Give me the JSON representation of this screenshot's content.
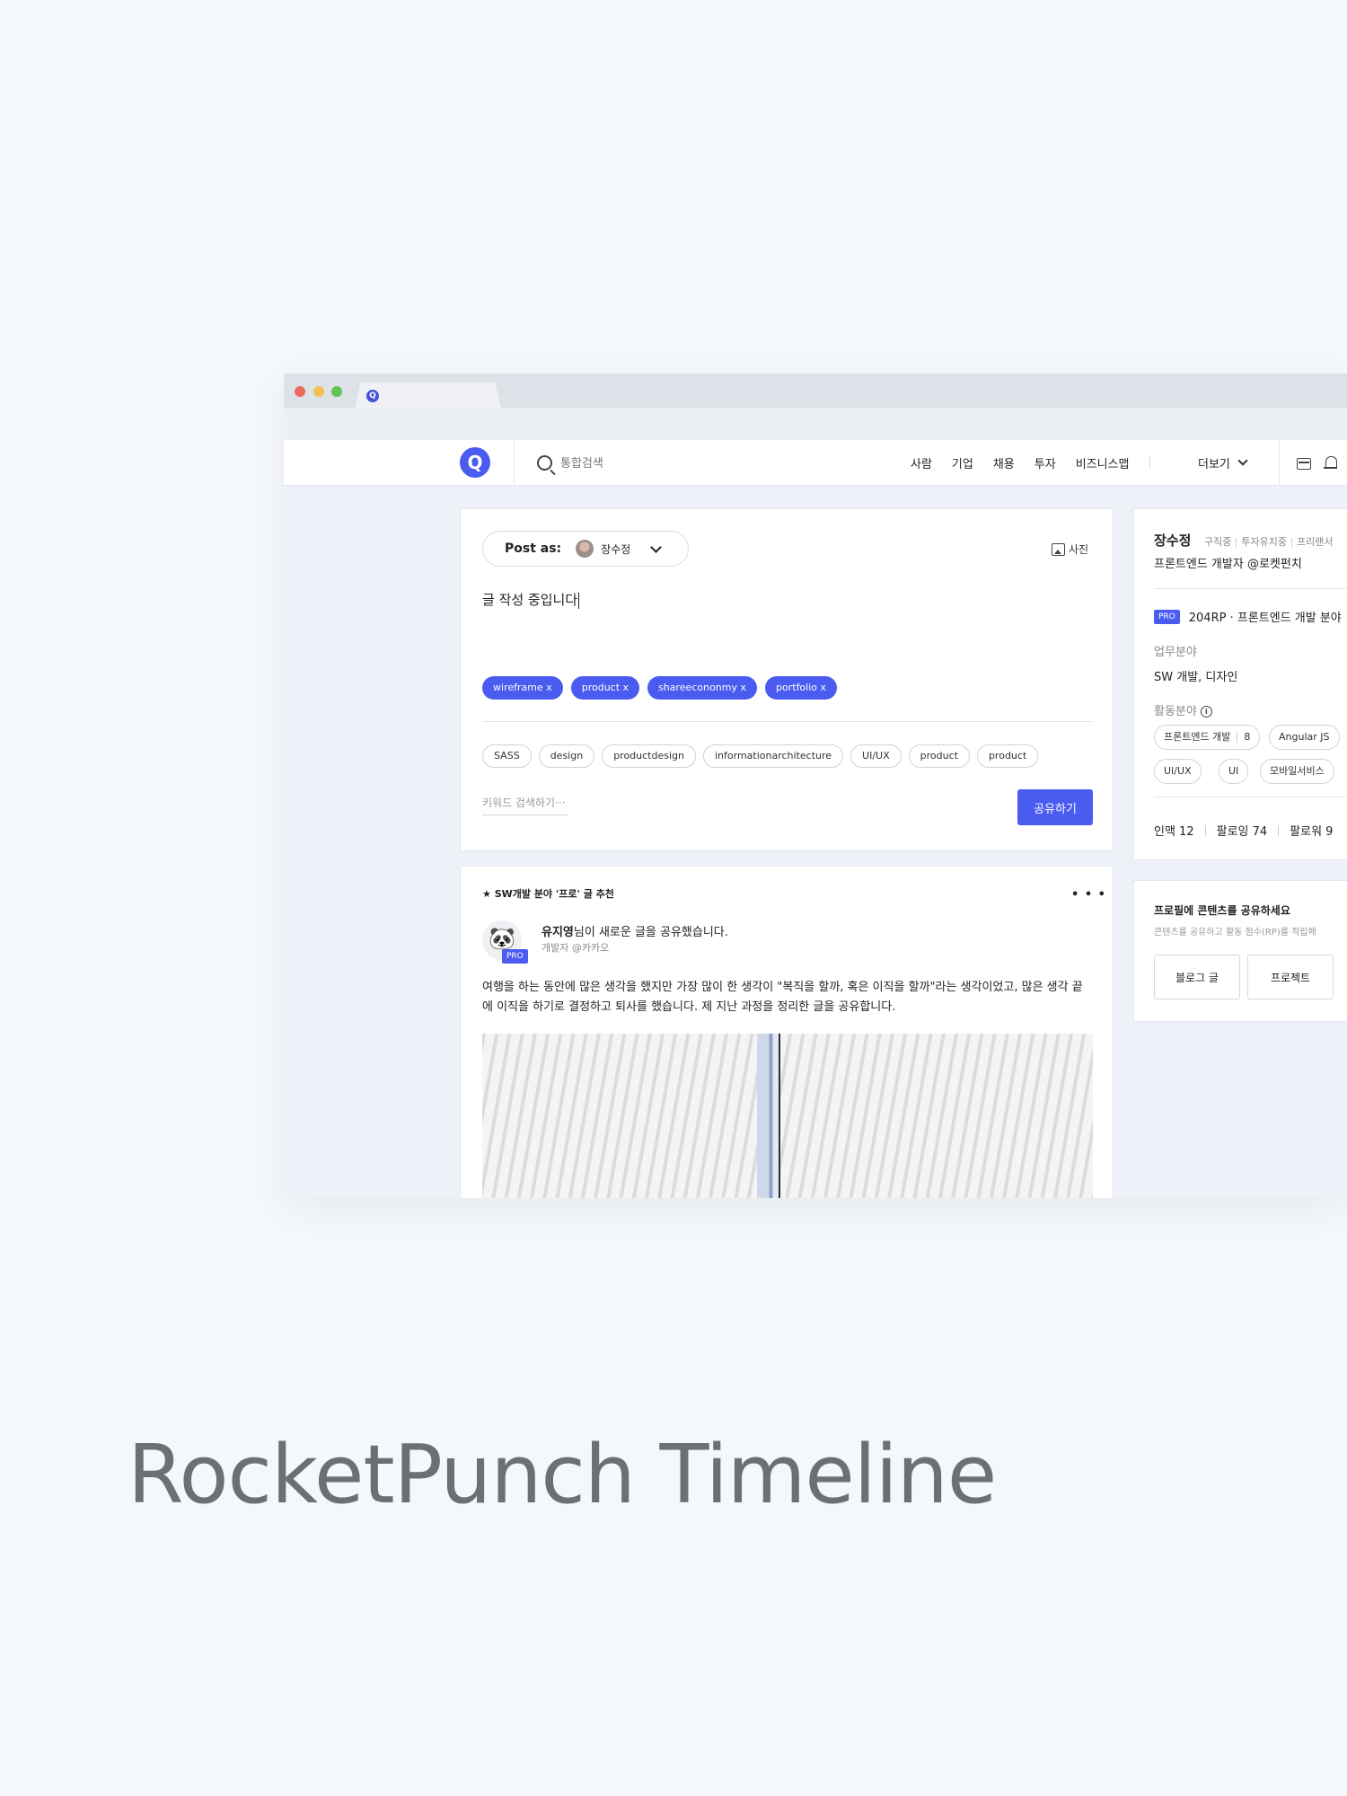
{
  "header": {
    "logo_letter": "Q",
    "search_placeholder": "통합검색",
    "nav": [
      "사람",
      "기업",
      "채용",
      "투자",
      "비즈니스맵"
    ],
    "more_label": "더보기"
  },
  "composer": {
    "post_as_label": "Post as:",
    "post_as_name": "장수정",
    "photo_label": "사진",
    "text": "글 작성 중입니다",
    "selected_tags": [
      "wireframe x",
      "product x",
      "shareecononmy x",
      "portfolio x"
    ],
    "keywords": [
      "SASS",
      "design",
      "productdesign",
      "informationarchitecture",
      "UI/UX",
      "product",
      "product"
    ],
    "keyword_search_placeholder": "키워드 검색하기···",
    "share_button": "공유하기"
  },
  "feed": {
    "recommend_label": "★ SW개발 분야 '프로' 글 추천",
    "author_name": "유지영",
    "author_action": "님이 새로운 글을 공유했습니다.",
    "author_sub": "개발자 @카카오",
    "pro_badge": "PRO",
    "body": "여행을 하는 동안에 많은 생각을 했지만 가장 많이 한 생각이 \"복직을 할까, 혹은 이직을 할까\"라는 생각이었고, 많은 생각 끝에 이직을 하기로 결정하고 퇴사를 했습니다. 제 지난 과정을 정리한 글을 공유합니다."
  },
  "profile": {
    "name": "장수정",
    "status_tags": [
      "구직중",
      "투자유치중",
      "프리랜서"
    ],
    "title": "프론트엔드 개발자 @로켓펀치",
    "pro_badge": "PRO",
    "rp_text": "204RP · 프론트엔드 개발 분야",
    "work_field_label": "업무분야",
    "work_field_value": "SW 개발, 디자인",
    "activity_label": "활동분야",
    "skills": [
      {
        "name": "프론트엔드 개발",
        "count": "8"
      },
      {
        "name": "Angular JS",
        "count": ""
      },
      {
        "name": "UI/UX",
        "count": ""
      },
      {
        "name": "UI",
        "count": ""
      },
      {
        "name": "모바일서비스",
        "count": ""
      }
    ],
    "stats": [
      "인맥 12",
      "팔로잉 74",
      "팔로워 9"
    ]
  },
  "sharebox": {
    "title": "프로필에 콘텐츠를 공유하세요",
    "subtitle": "콘텐츠를 공유하고 활동 점수(RP)를 적립해",
    "buttons": [
      "블로그 글",
      "프로젝트"
    ]
  },
  "caption": {
    "bold": "RocketPunch",
    "rest": " Timeline"
  }
}
